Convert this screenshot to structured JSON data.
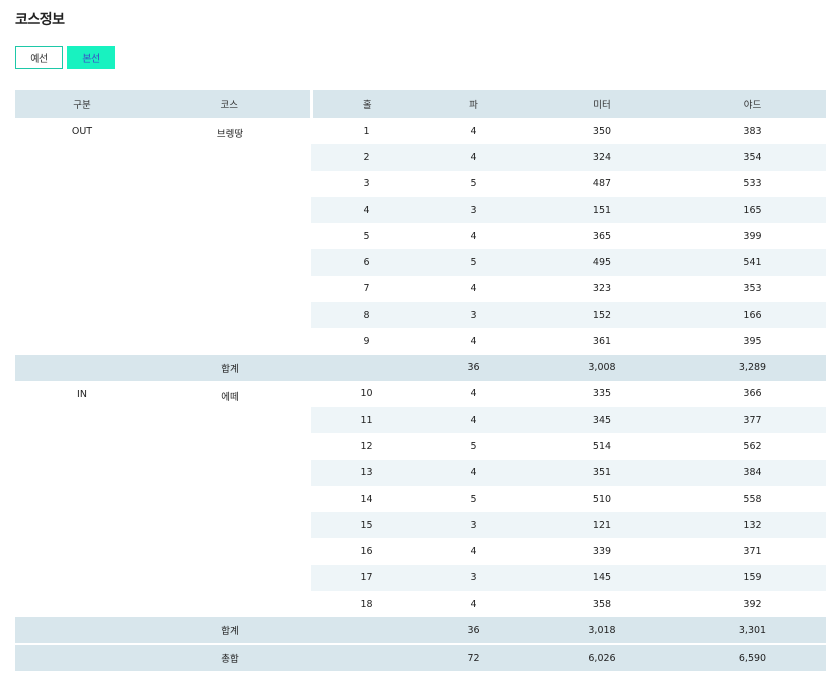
{
  "page": {
    "title": "코스정보"
  },
  "tabs": [
    {
      "label": "예선",
      "active": false
    },
    {
      "label": "본선",
      "active": true
    }
  ],
  "table": {
    "headers": [
      "구분",
      "코스",
      "홀",
      "파",
      "미터",
      "야드"
    ],
    "groups": [
      {
        "division": "OUT",
        "course": "브렝땅",
        "rows": [
          {
            "hole": "1",
            "par": "4",
            "meter": "350",
            "yard": "383"
          },
          {
            "hole": "2",
            "par": "4",
            "meter": "324",
            "yard": "354"
          },
          {
            "hole": "3",
            "par": "5",
            "meter": "487",
            "yard": "533"
          },
          {
            "hole": "4",
            "par": "3",
            "meter": "151",
            "yard": "165"
          },
          {
            "hole": "5",
            "par": "4",
            "meter": "365",
            "yard": "399"
          },
          {
            "hole": "6",
            "par": "5",
            "meter": "495",
            "yard": "541"
          },
          {
            "hole": "7",
            "par": "4",
            "meter": "323",
            "yard": "353"
          },
          {
            "hole": "8",
            "par": "3",
            "meter": "152",
            "yard": "166"
          },
          {
            "hole": "9",
            "par": "4",
            "meter": "361",
            "yard": "395"
          }
        ],
        "subtotal": {
          "label": "합계",
          "par": "36",
          "meter": "3,008",
          "yard": "3,289"
        }
      },
      {
        "division": "IN",
        "course": "에떼",
        "rows": [
          {
            "hole": "10",
            "par": "4",
            "meter": "335",
            "yard": "366"
          },
          {
            "hole": "11",
            "par": "4",
            "meter": "345",
            "yard": "377"
          },
          {
            "hole": "12",
            "par": "5",
            "meter": "514",
            "yard": "562"
          },
          {
            "hole": "13",
            "par": "4",
            "meter": "351",
            "yard": "384"
          },
          {
            "hole": "14",
            "par": "5",
            "meter": "510",
            "yard": "558"
          },
          {
            "hole": "15",
            "par": "3",
            "meter": "121",
            "yard": "132"
          },
          {
            "hole": "16",
            "par": "4",
            "meter": "339",
            "yard": "371"
          },
          {
            "hole": "17",
            "par": "3",
            "meter": "145",
            "yard": "159"
          },
          {
            "hole": "18",
            "par": "4",
            "meter": "358",
            "yard": "392"
          }
        ],
        "subtotal": {
          "label": "합계",
          "par": "36",
          "meter": "3,018",
          "yard": "3,301"
        }
      }
    ],
    "total": {
      "label": "총합",
      "par": "72",
      "meter": "6,026",
      "yard": "6,590"
    }
  },
  "colors": {
    "accent": "#18f2c0",
    "tab_border": "#1ec8a8",
    "header_bg": "#d8e6ec",
    "alt_row_bg": "#eef5f8"
  }
}
